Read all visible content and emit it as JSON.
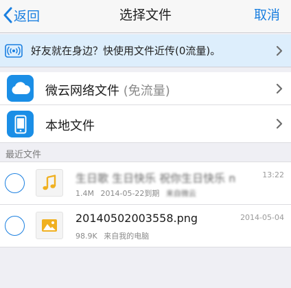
{
  "navbar": {
    "back_label": "返回",
    "title": "选择文件",
    "cancel_label": "取消"
  },
  "banner": {
    "text": "好友就在身边？快使用文件近传(0流量)。",
    "icon": "radio-broadcast-icon"
  },
  "sources": [
    {
      "label": "微云网络文件",
      "note": "(免流量)",
      "icon": "cloud-icon"
    },
    {
      "label": "本地文件",
      "note": "",
      "icon": "phone-icon"
    }
  ],
  "recent": {
    "header": "最近文件",
    "files": [
      {
        "name": "生日歌 生日快乐 祝你生日快乐 mp3",
        "size": "1.4M",
        "expiry": "2014-05-22到期",
        "source": "来自微云",
        "date": "13:22",
        "icon": "music-note-icon"
      },
      {
        "name": "20140502003558.png",
        "size": "98.9K",
        "source": "来自我的电脑",
        "date": "2014-05-04",
        "icon": "image-icon"
      }
    ]
  },
  "colors": {
    "accent": "#1a7fe0",
    "banner_bg": "#ddeefc",
    "page_bg": "#efeff4"
  }
}
